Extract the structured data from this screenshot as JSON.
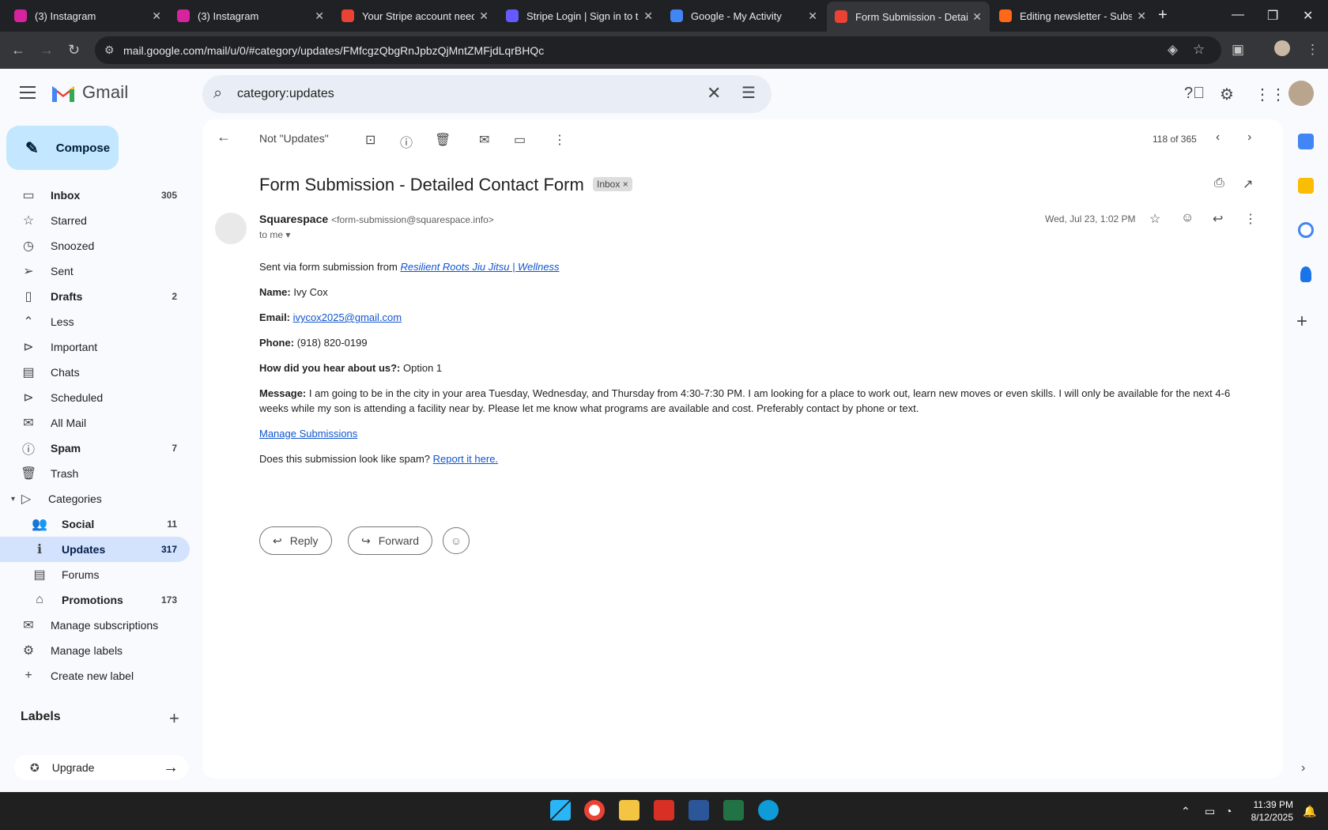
{
  "browser": {
    "tabs": [
      {
        "title": "(3) Instagram",
        "fav": "#d6249f"
      },
      {
        "title": "(3) Instagram",
        "fav": "#d6249f"
      },
      {
        "title": "Your Stripe account needs",
        "fav": "#ea4335"
      },
      {
        "title": "Stripe Login | Sign in to the",
        "fav": "#635bff"
      },
      {
        "title": "Google - My Activity",
        "fav": "#4285f4"
      },
      {
        "title": "Form Submission - Detailed",
        "fav": "#ea4335"
      },
      {
        "title": "Editing newsletter - Substack",
        "fav": "#ff6719"
      }
    ],
    "url": "mail.google.com/mail/u/0/#category/updates/FMfcgzQbgRnJpbzQjMntZMFjdLqrBHQc"
  },
  "gmail": {
    "logo_text": "Gmail",
    "search_query": "category:updates",
    "compose_label": "Compose",
    "nav": [
      {
        "label": "Inbox",
        "count": "305",
        "icon": "inbox-icon",
        "glyph": "▭",
        "bold": true
      },
      {
        "label": "Starred",
        "count": "",
        "icon": "star-icon",
        "glyph": "☆"
      },
      {
        "label": "Snoozed",
        "count": "",
        "icon": "clock-icon",
        "glyph": "◷"
      },
      {
        "label": "Sent",
        "count": "",
        "icon": "send-icon",
        "glyph": "➢"
      },
      {
        "label": "Drafts",
        "count": "2",
        "icon": "draft-icon",
        "glyph": "▯",
        "bold": true
      },
      {
        "label": "Less",
        "count": "",
        "icon": "chevron-up-icon",
        "glyph": "⌃"
      },
      {
        "label": "Important",
        "count": "",
        "icon": "important-icon",
        "glyph": "⊳"
      },
      {
        "label": "Chats",
        "count": "",
        "icon": "chat-icon",
        "glyph": "▤"
      },
      {
        "label": "Scheduled",
        "count": "",
        "icon": "scheduled-icon",
        "glyph": "⊳"
      },
      {
        "label": "All Mail",
        "count": "",
        "icon": "all-mail-icon",
        "glyph": "✉"
      },
      {
        "label": "Spam",
        "count": "7",
        "icon": "spam-icon",
        "glyph": "ⓘ",
        "bold": true
      },
      {
        "label": "Trash",
        "count": "",
        "icon": "trash-icon",
        "glyph": "🗑"
      },
      {
        "label": "Categories",
        "count": "",
        "icon": "label-icon",
        "glyph": "▷"
      },
      {
        "label": "Social",
        "count": "11",
        "icon": "people-icon",
        "glyph": "👥",
        "sub": true,
        "bold": true
      },
      {
        "label": "Updates",
        "count": "317",
        "icon": "info-icon",
        "glyph": "ℹ",
        "sub": true,
        "active": true
      },
      {
        "label": "Forums",
        "count": "",
        "icon": "forum-icon",
        "glyph": "▤",
        "sub": true
      },
      {
        "label": "Promotions",
        "count": "173",
        "icon": "tag-icon",
        "glyph": "⌂",
        "sub": true,
        "bold": true
      },
      {
        "label": "Manage subscriptions",
        "count": "",
        "icon": "subscriptions-icon",
        "glyph": "✉"
      },
      {
        "label": "Manage labels",
        "count": "",
        "icon": "gear-icon",
        "glyph": "⚙"
      },
      {
        "label": "Create new label",
        "count": "",
        "icon": "plus-icon",
        "glyph": "+"
      }
    ],
    "labels_heading": "Labels",
    "upgrade_label": "Upgrade"
  },
  "email": {
    "not_updates": "Not \"Updates\"",
    "pager": "118 of 365",
    "subject": "Form Submission - Detailed Contact Form",
    "chip": "Inbox",
    "sender_name": "Squarespace",
    "sender_email": "<form-submission@squarespace.info>",
    "to": "to me",
    "date": "Wed, Jul 23, 1:02 PM",
    "intro": "Sent via form submission from ",
    "intro_link": "Resilient Roots Jiu Jitsu | Wellness",
    "fields": [
      {
        "key": "Name:",
        "value": "Ivy Cox"
      },
      {
        "key": "Email:",
        "value": "ivycox2025@gmail.com",
        "link": true
      },
      {
        "key": "Phone:",
        "value": "(918) 820-0199"
      },
      {
        "key": "How did you hear about us?:",
        "value": "Option 1"
      },
      {
        "key": "Message:",
        "value": "I am going to be in the city in your area Tuesday, Wednesday, and Thursday from 4:30-7:30 PM. I am looking for a place to work out, learn new moves or even skills. I will only be available for the next 4-6 weeks while my son is attending a facility near by. Please let me know what programs are available and cost. Preferably contact by phone or text."
      }
    ],
    "manage_link": "Manage Submissions",
    "spam_q": "Does this submission look like spam? ",
    "spam_link": "Report it here.",
    "reply_label": "Reply",
    "forward_label": "Forward"
  },
  "taskbar": {
    "time": "11:39 PM",
    "date": "8/12/2025"
  }
}
